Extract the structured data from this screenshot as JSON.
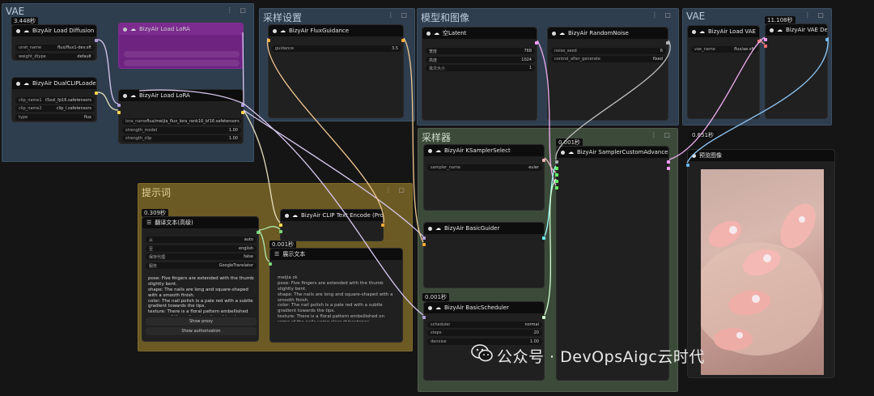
{
  "groups": {
    "vae_left": {
      "title": "VAE"
    },
    "sampling_settings": {
      "title": "采样设置"
    },
    "model_latent": {
      "title": "模型和图像"
    },
    "vae_right": {
      "title": "VAE"
    },
    "prompt": {
      "title": "提示词"
    },
    "sampler": {
      "title": "采样器"
    }
  },
  "timers": {
    "t1": "3.448秒",
    "t2": "0.309秒",
    "t3": "0.001秒",
    "t4": "0.001秒",
    "t5": "0.001秒",
    "t6": "11.108秒",
    "t7": "0.651秒"
  },
  "nodes": {
    "load_diffusion": {
      "title": "BizyAir Load Diffusion Model",
      "widgets": [
        {
          "label": "unet_name",
          "value": "flux/flux1-dev.sft"
        },
        {
          "label": "weight_dtype",
          "value": "default"
        }
      ]
    },
    "dual_clip": {
      "title": "BizyAir DualCLIPLoader",
      "widgets": [
        {
          "label": "clip_name1",
          "value": "t5xxl_fp16.safetensors"
        },
        {
          "label": "clip_name2",
          "value": "clip_l.safetensors"
        },
        {
          "label": "type",
          "value": "flux"
        }
      ]
    },
    "load_lora_bypassed": {
      "title": "BizyAir Load LoRA"
    },
    "load_lora": {
      "title": "BizyAir Load LoRA",
      "widgets": [
        {
          "label": "lora_name",
          "value": "flux/meijia_flux_lora_rank16_bf16.safetensors"
        },
        {
          "label": "strength_model",
          "value": "1.00"
        },
        {
          "label": "strength_clip",
          "value": "1.00"
        }
      ]
    },
    "flux_guidance": {
      "title": "BizyAir FluxGuidance",
      "widgets": [
        {
          "label": "guidance",
          "value": "3.5"
        }
      ]
    },
    "empty_latent": {
      "title": "空Latent",
      "widgets": [
        {
          "label": "宽度",
          "value": "768"
        },
        {
          "label": "高度",
          "value": "1024"
        },
        {
          "label": "批次大小",
          "value": "1"
        }
      ]
    },
    "random_noise": {
      "title": "BizyAir RandomNoise",
      "widgets": [
        {
          "label": "noise_seed",
          "value": "6"
        },
        {
          "label": "control_after_generate",
          "value": "fixed"
        }
      ]
    },
    "load_vae": {
      "title": "BizyAir Load VAE",
      "widgets": [
        {
          "label": "vae_name",
          "value": "flux/ae.sft"
        }
      ]
    },
    "vae_decode": {
      "title": "BizyAir VAE Decode"
    },
    "translate": {
      "title": "翻译文本(高级)",
      "widgets": [
        {
          "label": "从",
          "value": "auto"
        },
        {
          "label": "至",
          "value": "english"
        },
        {
          "label": "保存代理",
          "value": "false"
        },
        {
          "label": "服务",
          "value": "GoogleTranslator"
        }
      ],
      "text": "pose: Five fingers are extended with the thumb slightly bent.\nshape: The nails are long and square-shaped with a smooth finish.\ncolor: The nail polish is a pale red with a subtle gradient towards the tips.\ntexture: There is a floral pattern embellished on some of the nails using clear rhinestones.",
      "btn1": "Show proxy",
      "btn2": "Show authorization"
    },
    "clip_encode": {
      "title": "BizyAir CLIP Text Encode (Prompt)"
    },
    "show_text": {
      "title": "展示文本",
      "text": "meijia zk\npose: Five fingers are extended with the thumb slightly bent.\nshape: The nails are long and square-shaped with a smooth finish.\ncolor: The nail polish is a pale red with a subtle gradient towards the tips.\ntexture: There is a floral pattern embellished on some of the nails using clear rhinestones."
    },
    "ksampler_select": {
      "title": "BizyAir KSamplerSelect",
      "widgets": [
        {
          "label": "sampler_name",
          "value": "euler"
        }
      ]
    },
    "sampler_custom": {
      "title": "BizyAir SamplerCustomAdvanced"
    },
    "basic_guider": {
      "title": "BizyAir BasicGuider"
    },
    "basic_scheduler": {
      "title": "BizyAir BasicScheduler",
      "widgets": [
        {
          "label": "scheduler",
          "value": "normal"
        },
        {
          "label": "steps",
          "value": "20"
        },
        {
          "label": "denoise",
          "value": "1.00"
        }
      ]
    },
    "preview": {
      "title": "预览图像"
    }
  },
  "watermark": {
    "text": "公众号 · DevOpsAigc云时代"
  },
  "colors": {
    "model_port": "#b39ddb",
    "clip_port": "#ffd54f",
    "cond_port": "#ffa931",
    "latent_port": "#ff9cf9",
    "vae_port": "#ff6e6e",
    "image_port": "#64b5f6",
    "noise_port": "#b0b0b0",
    "guider_port": "#66ffff",
    "sampler_port": "#ecb4b4",
    "sigmas_port": "#cdffcd"
  }
}
